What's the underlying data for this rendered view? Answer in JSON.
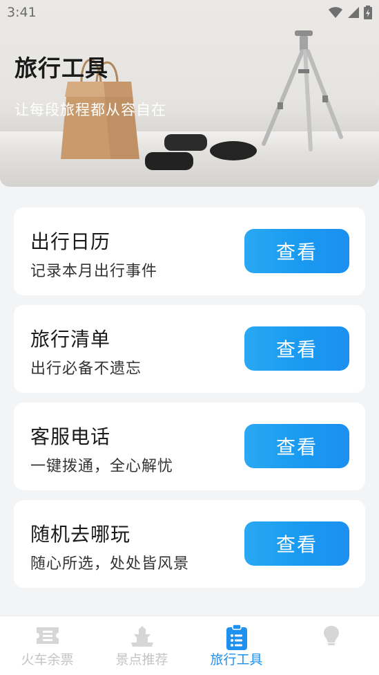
{
  "status_bar": {
    "time": "3:41"
  },
  "hero": {
    "title": "旅行工具",
    "subtitle": "让每段旅程都从容自在"
  },
  "tools": [
    {
      "title": "出行日历",
      "desc": "记录本月出行事件",
      "button": "查看"
    },
    {
      "title": "旅行清单",
      "desc": "出行必备不遗忘",
      "button": "查看"
    },
    {
      "title": "客服电话",
      "desc": "一键拨通，全心解忧",
      "button": "查看"
    },
    {
      "title": "随机去哪玩",
      "desc": "随心所选，处处皆风景",
      "button": "查看"
    }
  ],
  "bottom_nav": {
    "items": [
      {
        "label": "火车余票",
        "icon": "ticket-icon",
        "active": false
      },
      {
        "label": "景点推荐",
        "icon": "temple-icon",
        "active": false
      },
      {
        "label": "旅行工具",
        "icon": "clipboard-list-icon",
        "active": true
      },
      {
        "label": "",
        "icon": "lightbulb-icon",
        "active": false
      }
    ]
  },
  "colors": {
    "accent": "#1e90f0",
    "button_gradient_start": "#2aa8f3",
    "button_gradient_end": "#1b8ff0",
    "inactive_nav": "#c4c4c4",
    "background": "#f3f4f6"
  }
}
